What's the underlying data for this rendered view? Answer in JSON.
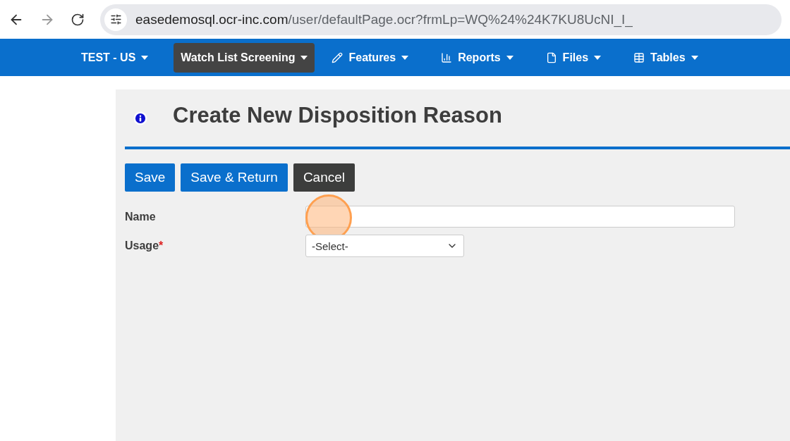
{
  "browser": {
    "url_host": "easedemosql.ocr-inc.com",
    "url_path": "/user/defaultPage.ocr?frmLp=WQ%24%24K7KU8UcNI_I_"
  },
  "nav": [
    {
      "label": "TEST - US",
      "kind": "plain",
      "selected": false
    },
    {
      "label": "Watch List Screening",
      "kind": "plain",
      "selected": true
    },
    {
      "label": "Features",
      "kind": "pencil",
      "selected": false
    },
    {
      "label": "Reports",
      "kind": "chart",
      "selected": false
    },
    {
      "label": "Files",
      "kind": "file",
      "selected": false
    },
    {
      "label": "Tables",
      "kind": "table",
      "selected": false
    }
  ],
  "page": {
    "title": "Create New Disposition Reason"
  },
  "buttons": [
    {
      "label": "Save",
      "kind": "primary"
    },
    {
      "label": "Save & Return",
      "kind": "primary"
    },
    {
      "label": "Cancel",
      "kind": "dark"
    }
  ],
  "fields": [
    {
      "label": "Name",
      "kind": "text",
      "click_marker": true
    },
    {
      "label": "Usage",
      "kind": "select",
      "required_mark": "*",
      "value": "-Select-",
      "click_marker": false
    }
  ]
}
